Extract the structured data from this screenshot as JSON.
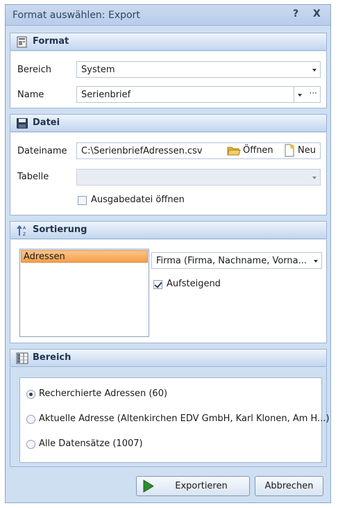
{
  "window": {
    "title": "Format auswählen: Export",
    "help_label": "?",
    "close_label": "X"
  },
  "format": {
    "header": "Format",
    "bereich_label": "Bereich",
    "bereich_value": "System",
    "name_label": "Name",
    "name_value": "Serienbrief",
    "more_label": "···"
  },
  "datei": {
    "header": "Datei",
    "dateiname_label": "Dateiname",
    "dateiname_value": "C:\\SerienbriefAdressen.csv",
    "open_label": "Öffnen",
    "new_label": "Neu",
    "tabelle_label": "Tabelle",
    "tabelle_value": "",
    "ausgabe_label": "Ausgabedatei öffnen",
    "ausgabe_checked": false
  },
  "sortierung": {
    "header": "Sortierung",
    "list_items": [
      "Adressen"
    ],
    "field_value": "Firma (Firma, Nachname, Vorna...",
    "aufsteigend_label": "Aufsteigend",
    "aufsteigend_checked": true
  },
  "bereich": {
    "header": "Bereich",
    "options": [
      {
        "label": "Recherchierte Adressen (60)",
        "selected": true
      },
      {
        "label": "Aktuelle Adresse (Altenkirchen EDV GmbH, Karl Klonen, Am H...)",
        "selected": false
      },
      {
        "label": "Alle Datensätze (1007)",
        "selected": false
      }
    ]
  },
  "buttons": {
    "export_label": "Exportieren",
    "cancel_label": "Abbrechen"
  },
  "colors": {
    "accent_selection": "#f5a04a",
    "export_icon_green": "#2e8b2e",
    "folder_yellow": "#e7b43c"
  }
}
